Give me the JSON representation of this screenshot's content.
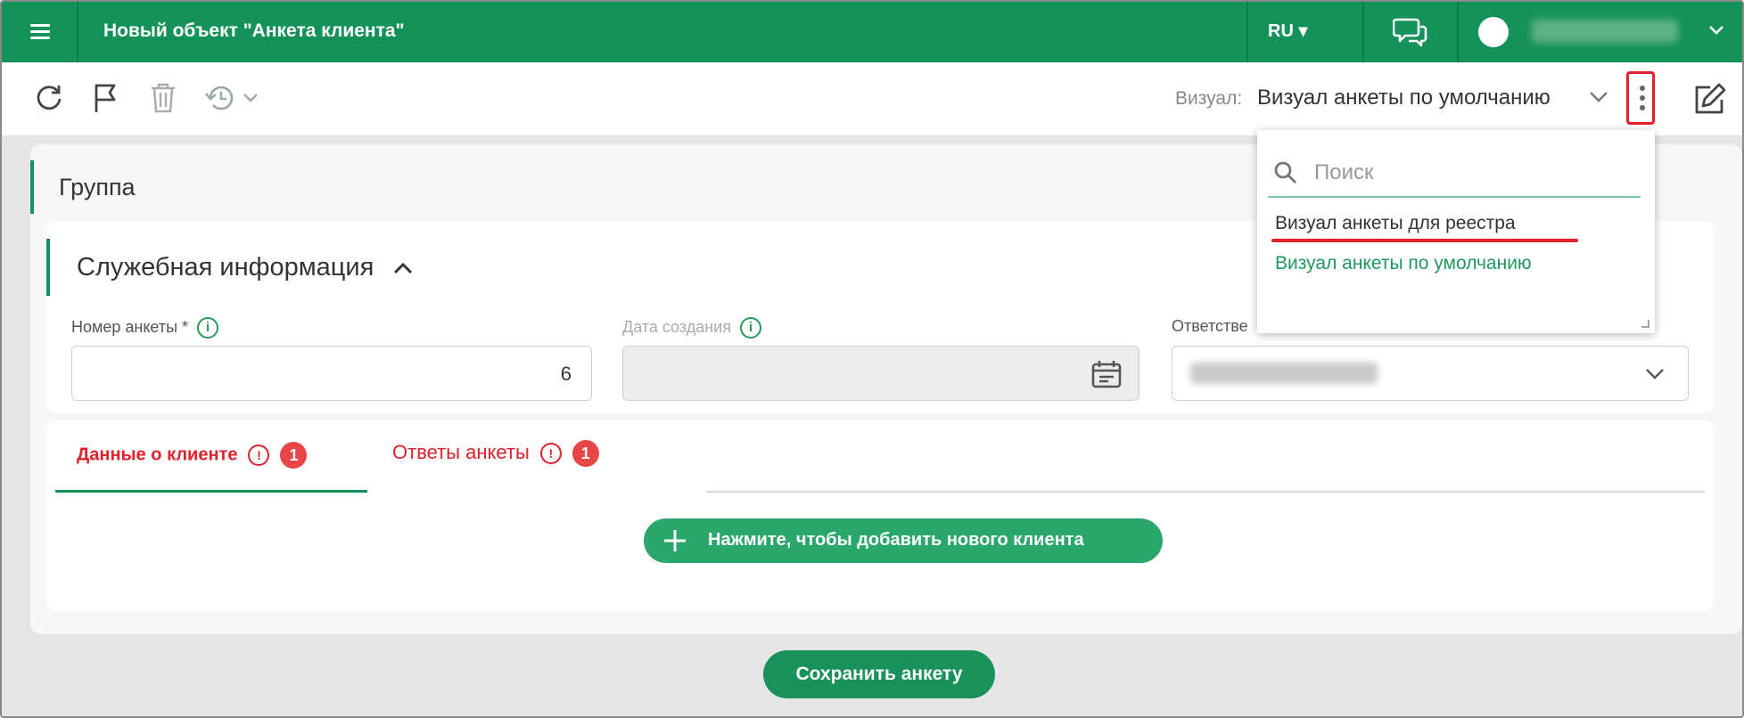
{
  "header": {
    "title": "Новый объект \"Анкета клиента\"",
    "language": "RU ▾",
    "menu_icon": "menu-icon",
    "chat_icon": "chat-icon",
    "user_chevron": "⌄"
  },
  "toolbar": {
    "icons": [
      "refresh-icon",
      "flag-icon",
      "trash-icon",
      "history-icon"
    ],
    "visual_label": "Визуал:",
    "visual_value": "Визуал анкеты по умолчанию"
  },
  "form": {
    "group_title": "Группа",
    "section_title": "Служебная информация",
    "fields": {
      "number_label": "Номер анкеты *",
      "number_value": "6",
      "created_label": "Дата создания",
      "responsible_label": "Ответстве"
    }
  },
  "tabs": [
    {
      "label": "Данные о клиенте",
      "count": "1"
    },
    {
      "label": "Ответы анкеты",
      "count": "1"
    }
  ],
  "add_client_label": "Нажмите, чтобы добавить нового клиента",
  "save_label": "Сохранить анкету",
  "dropdown": {
    "search_placeholder": "Поиск",
    "items": [
      "Визуал анкеты для реестра",
      "Визуал анкеты по умолчанию"
    ]
  },
  "colors": {
    "brand_green": "#15925a",
    "error_red": "#e0202a",
    "selected_green": "#1f9a5e"
  }
}
